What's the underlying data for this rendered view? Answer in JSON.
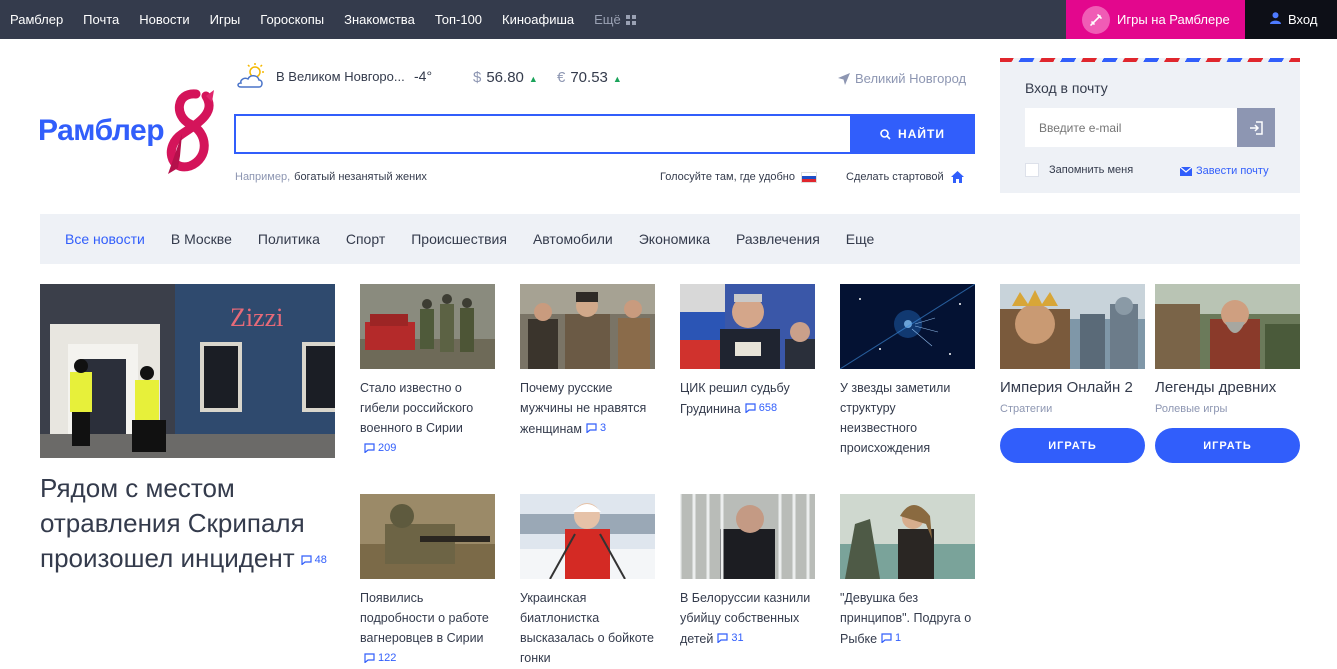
{
  "topbar": {
    "nav": [
      "Рамблер",
      "Почта",
      "Новости",
      "Игры",
      "Гороскопы",
      "Знакомства",
      "Топ-100",
      "Киноафиша"
    ],
    "more": "Ещё",
    "games_button": "Игры на Рамблере",
    "login": "Вход"
  },
  "logo": {
    "text": "Рамблер"
  },
  "weather": {
    "city": "В Великом Новгоро...",
    "temp": "-4°"
  },
  "currency": {
    "usd_symbol": "$",
    "usd": "56.80",
    "eur_symbol": "€",
    "eur": "70.53"
  },
  "location": "Великий Новгород",
  "search": {
    "value": "",
    "button": "НАЙТИ",
    "example_label": "Например,",
    "example_query": "богатый незанятый жених"
  },
  "links": {
    "vote": "Голосуйте там, где удобно",
    "homepage": "Сделать стартовой"
  },
  "mail": {
    "title": "Вход в почту",
    "email_placeholder": "Введите e-mail",
    "remember": "Запомнить меня",
    "create": "Завести почту"
  },
  "newsnav": [
    "Все новости",
    "В Москве",
    "Политика",
    "Спорт",
    "Происшествия",
    "Автомобили",
    "Экономика",
    "Развлечения",
    "Еще"
  ],
  "main_news": {
    "headline": "Рядом с местом отравления Скрипаля произошел инцидент",
    "comments": "48"
  },
  "news": [
    {
      "title": "Стало известно о гибели российского военного в Сирии",
      "comments": "209"
    },
    {
      "title": "Почему русские мужчины не нравятся женщинам",
      "comments": "3"
    },
    {
      "title": "ЦИК решил судьбу Грудинина",
      "comments": "658"
    },
    {
      "title": "У звезды заметили структуру неизвестного происхождения",
      "comments": ""
    },
    {
      "title": "Появились подробности о работе вагнеровцев в Сирии",
      "comments": "122"
    },
    {
      "title": "Украинская биатлонистка высказалась о бойкоте гонки",
      "comments": ""
    },
    {
      "title": "В Белоруссии казнили убийцу собственных детей",
      "comments": "31"
    },
    {
      "title": "\"Девушка без принципов\". Подруга о Рыбке",
      "comments": "1"
    }
  ],
  "games": [
    {
      "title": "Империя Онлайн 2",
      "category": "Стратегии",
      "button": "ИГРАТЬ"
    },
    {
      "title": "Легенды древних",
      "category": "Ролевые игры",
      "button": "ИГРАТЬ"
    }
  ],
  "colors": {
    "brand": "#315efb",
    "topbar": "#343b4c",
    "games_pink": "#e3078d",
    "text": "#343b4c",
    "muted": "#8d96b2"
  }
}
